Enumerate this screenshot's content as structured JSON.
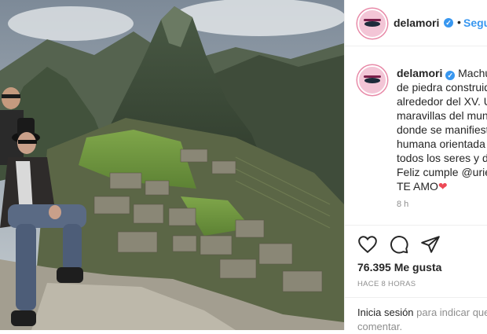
{
  "photo": {
    "description_icon": "photo-machu-picchu"
  },
  "header": {
    "username": "delamori",
    "separator": "•",
    "follow_label": "Seguir",
    "verified_mark": "✓"
  },
  "caption": {
    "username": "delamori",
    "lines": [
      "Machu Picchu (an",
      "de piedra construida",
      "alrededor del XV. U",
      "maravillas del mundo",
      "donde se manifiesta",
      "humana orientada a",
      "todos los seres y de",
      "Feliz cumple @uriel",
      "TE AMO"
    ],
    "heart": "❤",
    "time": "8 h"
  },
  "actions": {
    "likes": "76.395 Me gusta",
    "posted": "HACE 8 HORAS"
  },
  "footer": {
    "login_link": "Inicia sesión",
    "login_rest": " para indicar que",
    "login_rest2": "comentar."
  },
  "colors": {
    "accent": "#3897f0",
    "heart": "#ed4956",
    "muted": "#8e8e8e"
  }
}
